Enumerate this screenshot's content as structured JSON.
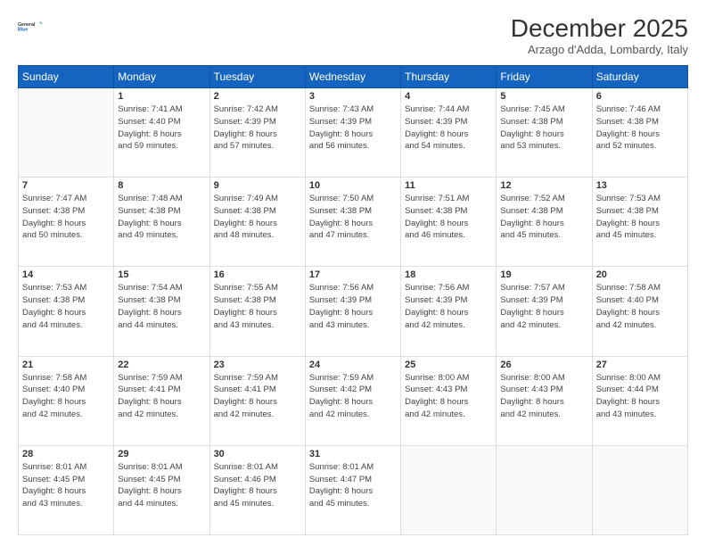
{
  "logo": {
    "line1": "General",
    "line2": "Blue"
  },
  "title": "December 2025",
  "location": "Arzago d'Adda, Lombardy, Italy",
  "weekdays": [
    "Sunday",
    "Monday",
    "Tuesday",
    "Wednesday",
    "Thursday",
    "Friday",
    "Saturday"
  ],
  "weeks": [
    [
      {
        "day": "",
        "info": ""
      },
      {
        "day": "1",
        "info": "Sunrise: 7:41 AM\nSunset: 4:40 PM\nDaylight: 8 hours\nand 59 minutes."
      },
      {
        "day": "2",
        "info": "Sunrise: 7:42 AM\nSunset: 4:39 PM\nDaylight: 8 hours\nand 57 minutes."
      },
      {
        "day": "3",
        "info": "Sunrise: 7:43 AM\nSunset: 4:39 PM\nDaylight: 8 hours\nand 56 minutes."
      },
      {
        "day": "4",
        "info": "Sunrise: 7:44 AM\nSunset: 4:39 PM\nDaylight: 8 hours\nand 54 minutes."
      },
      {
        "day": "5",
        "info": "Sunrise: 7:45 AM\nSunset: 4:38 PM\nDaylight: 8 hours\nand 53 minutes."
      },
      {
        "day": "6",
        "info": "Sunrise: 7:46 AM\nSunset: 4:38 PM\nDaylight: 8 hours\nand 52 minutes."
      }
    ],
    [
      {
        "day": "7",
        "info": "Sunrise: 7:47 AM\nSunset: 4:38 PM\nDaylight: 8 hours\nand 50 minutes."
      },
      {
        "day": "8",
        "info": "Sunrise: 7:48 AM\nSunset: 4:38 PM\nDaylight: 8 hours\nand 49 minutes."
      },
      {
        "day": "9",
        "info": "Sunrise: 7:49 AM\nSunset: 4:38 PM\nDaylight: 8 hours\nand 48 minutes."
      },
      {
        "day": "10",
        "info": "Sunrise: 7:50 AM\nSunset: 4:38 PM\nDaylight: 8 hours\nand 47 minutes."
      },
      {
        "day": "11",
        "info": "Sunrise: 7:51 AM\nSunset: 4:38 PM\nDaylight: 8 hours\nand 46 minutes."
      },
      {
        "day": "12",
        "info": "Sunrise: 7:52 AM\nSunset: 4:38 PM\nDaylight: 8 hours\nand 45 minutes."
      },
      {
        "day": "13",
        "info": "Sunrise: 7:53 AM\nSunset: 4:38 PM\nDaylight: 8 hours\nand 45 minutes."
      }
    ],
    [
      {
        "day": "14",
        "info": "Sunrise: 7:53 AM\nSunset: 4:38 PM\nDaylight: 8 hours\nand 44 minutes."
      },
      {
        "day": "15",
        "info": "Sunrise: 7:54 AM\nSunset: 4:38 PM\nDaylight: 8 hours\nand 44 minutes."
      },
      {
        "day": "16",
        "info": "Sunrise: 7:55 AM\nSunset: 4:38 PM\nDaylight: 8 hours\nand 43 minutes."
      },
      {
        "day": "17",
        "info": "Sunrise: 7:56 AM\nSunset: 4:39 PM\nDaylight: 8 hours\nand 43 minutes."
      },
      {
        "day": "18",
        "info": "Sunrise: 7:56 AM\nSunset: 4:39 PM\nDaylight: 8 hours\nand 42 minutes."
      },
      {
        "day": "19",
        "info": "Sunrise: 7:57 AM\nSunset: 4:39 PM\nDaylight: 8 hours\nand 42 minutes."
      },
      {
        "day": "20",
        "info": "Sunrise: 7:58 AM\nSunset: 4:40 PM\nDaylight: 8 hours\nand 42 minutes."
      }
    ],
    [
      {
        "day": "21",
        "info": "Sunrise: 7:58 AM\nSunset: 4:40 PM\nDaylight: 8 hours\nand 42 minutes."
      },
      {
        "day": "22",
        "info": "Sunrise: 7:59 AM\nSunset: 4:41 PM\nDaylight: 8 hours\nand 42 minutes."
      },
      {
        "day": "23",
        "info": "Sunrise: 7:59 AM\nSunset: 4:41 PM\nDaylight: 8 hours\nand 42 minutes."
      },
      {
        "day": "24",
        "info": "Sunrise: 7:59 AM\nSunset: 4:42 PM\nDaylight: 8 hours\nand 42 minutes."
      },
      {
        "day": "25",
        "info": "Sunrise: 8:00 AM\nSunset: 4:43 PM\nDaylight: 8 hours\nand 42 minutes."
      },
      {
        "day": "26",
        "info": "Sunrise: 8:00 AM\nSunset: 4:43 PM\nDaylight: 8 hours\nand 42 minutes."
      },
      {
        "day": "27",
        "info": "Sunrise: 8:00 AM\nSunset: 4:44 PM\nDaylight: 8 hours\nand 43 minutes."
      }
    ],
    [
      {
        "day": "28",
        "info": "Sunrise: 8:01 AM\nSunset: 4:45 PM\nDaylight: 8 hours\nand 43 minutes."
      },
      {
        "day": "29",
        "info": "Sunrise: 8:01 AM\nSunset: 4:45 PM\nDaylight: 8 hours\nand 44 minutes."
      },
      {
        "day": "30",
        "info": "Sunrise: 8:01 AM\nSunset: 4:46 PM\nDaylight: 8 hours\nand 45 minutes."
      },
      {
        "day": "31",
        "info": "Sunrise: 8:01 AM\nSunset: 4:47 PM\nDaylight: 8 hours\nand 45 minutes."
      },
      {
        "day": "",
        "info": ""
      },
      {
        "day": "",
        "info": ""
      },
      {
        "day": "",
        "info": ""
      }
    ]
  ]
}
